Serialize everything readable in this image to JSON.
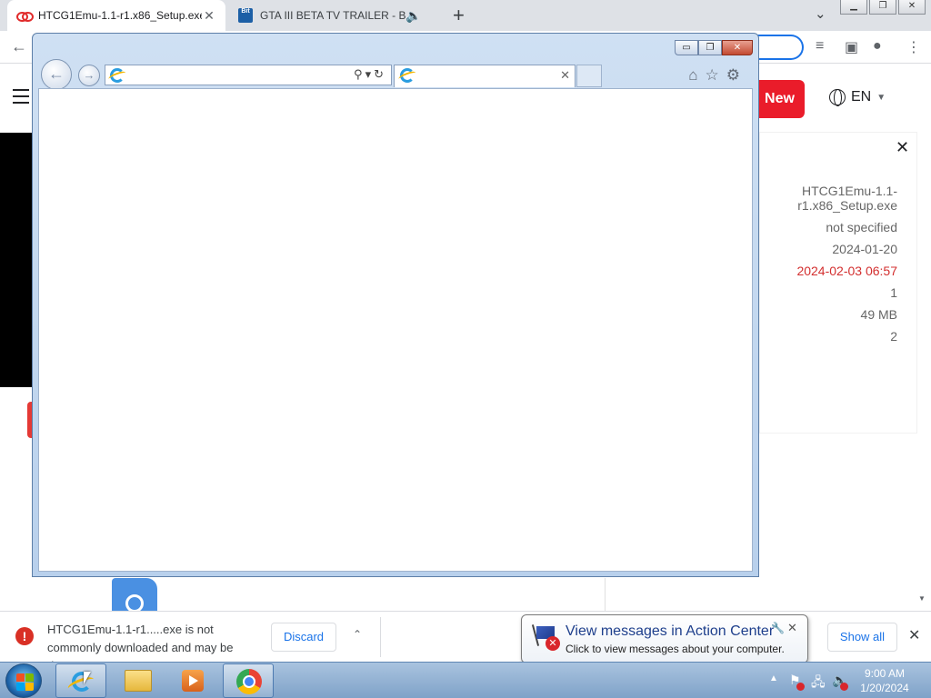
{
  "browser": {
    "tabs": [
      {
        "title": "HTCG1Emu-1.1-r1.x86_Setup.exe",
        "active": true
      },
      {
        "title": "GTA III BETA TV TRAILER - Bi",
        "favicon_text": "Bit"
      }
    ],
    "new_tab_symbol": "+",
    "window_controls": [
      "▁",
      "❐",
      "✕"
    ]
  },
  "page": {
    "new_button": "New",
    "language": "EN",
    "details": {
      "filename": "HTCG1Emu-1.1-r1.x86_Setup.exe",
      "author": "not specified",
      "date_added": "2024-01-20",
      "date_updated": "2024-02-03 06:57",
      "version": "1",
      "size": "49 MB",
      "downloads": "2"
    },
    "accent_color": "#ea1c2a"
  },
  "ie_window": {
    "caption_buttons": [
      "▭",
      "❐",
      "✕"
    ]
  },
  "download_bar": {
    "message": "HTCG1Emu-1.1-r1.....exe is not commonly downloaded and may be dangerous.",
    "discard_label": "Discard",
    "show_all_label": "Show all"
  },
  "balloon": {
    "title": "View messages in Action Center",
    "subtitle": "Click to view messages about your computer."
  },
  "taskbar": {
    "time": "9:00 AM",
    "date": "1/20/2024"
  }
}
